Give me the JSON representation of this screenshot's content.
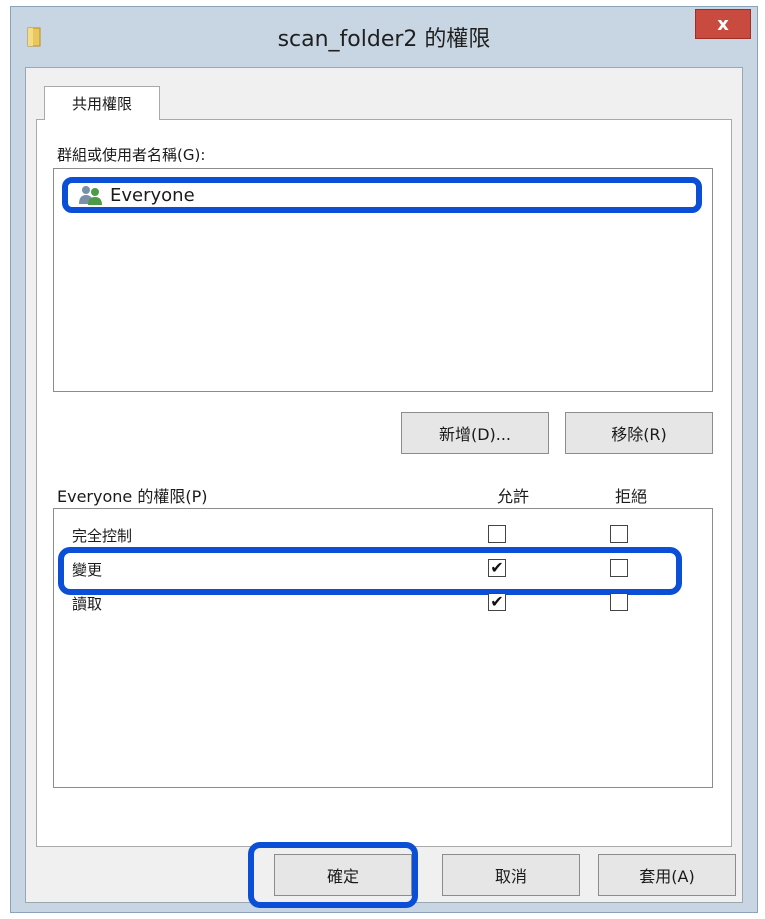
{
  "window": {
    "title": "scan_folder2 的權限",
    "close_label": "x"
  },
  "tab": {
    "label": "共用權限"
  },
  "groups": {
    "label": "群組或使用者名稱(G):",
    "items": [
      {
        "name": "Everyone",
        "icon": "users-icon",
        "selected": true
      }
    ]
  },
  "buttons": {
    "add": "新增(D)...",
    "remove": "移除(R)",
    "ok": "確定",
    "cancel": "取消",
    "apply": "套用(A)"
  },
  "permissions": {
    "label": "Everyone 的權限(P)",
    "allow_header": "允許",
    "deny_header": "拒絕",
    "rows": [
      {
        "name": "完全控制",
        "allow": false,
        "deny": false
      },
      {
        "name": "變更",
        "allow": true,
        "deny": false
      },
      {
        "name": "讀取",
        "allow": true,
        "deny": false
      }
    ]
  },
  "colors": {
    "highlight": "#0b4fd6",
    "close": "#c94a3f"
  }
}
